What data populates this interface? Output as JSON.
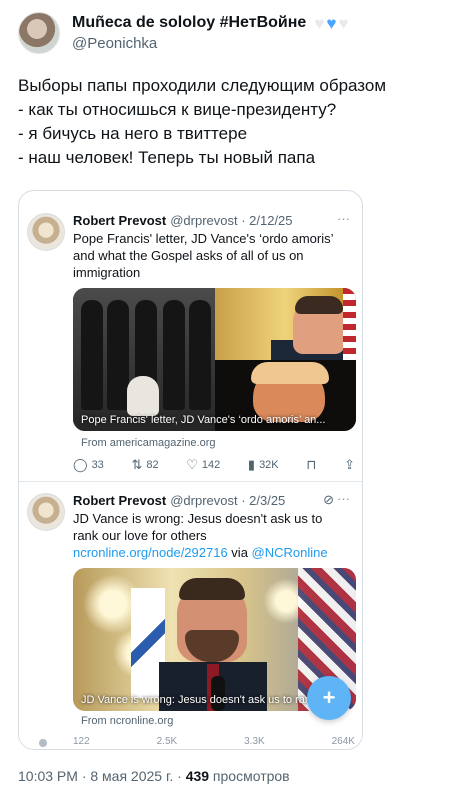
{
  "author": {
    "name": "Muñeca de sololoy #НетВойне",
    "handle": "@Peonichka"
  },
  "tweet": {
    "lines": [
      "Выборы папы проходили следующим образом",
      "- как ты относишься к вице-президенту?",
      "- я бичусь на него в твиттере",
      "- наш человек! Теперь ты новый папа"
    ]
  },
  "embedded": [
    {
      "name": "Robert Prevost",
      "meta": "@drprevost · 2/12/25",
      "more": "···",
      "body": "Pope Francis' letter, JD Vance's ‘ordo amoris’ and what the Gospel asks of all of us on immigration",
      "image_caption": "Pope Francis' letter, JD Vance's ‘ordo amoris’ an...",
      "source": "From americamagazine.org",
      "actions": {
        "replies": "33",
        "reposts": "82",
        "likes": "142",
        "views": "32K"
      }
    },
    {
      "name": "Robert Prevost",
      "meta": "@drprevost · 2/3/25",
      "more": "···",
      "muted": "⊘",
      "body_text": "JD Vance is wrong: Jesus doesn't ask us to rank our love for others ",
      "body_link1": "ncronline.org/node/292716",
      "body_via": " via ",
      "body_link2": "@NCRonline",
      "image_caption": "JD Vance is wrong: Jesus doesn't ask us to rank...",
      "source": "From ncronline.org",
      "actions": {
        "replies": "122",
        "reposts": "2.5K",
        "likes": "3.3K",
        "views": "264K"
      }
    }
  ],
  "footer": {
    "time": "10:03 PM · 8 мая 2025 г. · ",
    "views_count": "439",
    "views_label": " просмотров"
  },
  "colors": {
    "link": "#1d9bf0",
    "text": "#0f1419",
    "muted": "#536471"
  }
}
